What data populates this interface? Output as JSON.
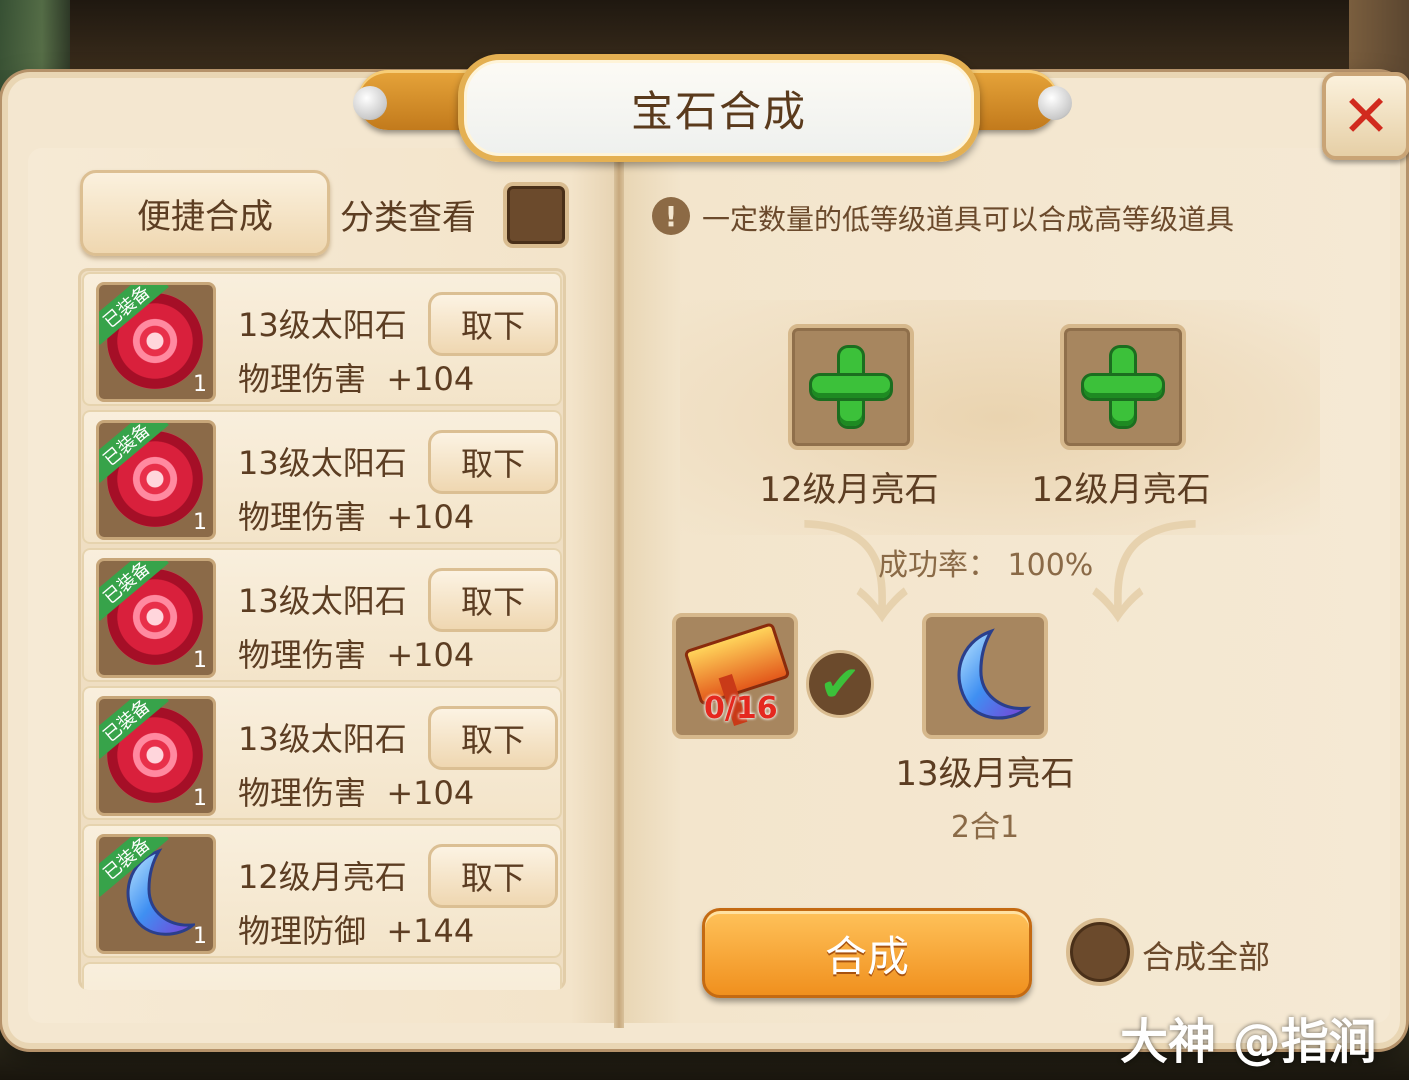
{
  "title": "宝石合成",
  "close_symbol": "✕",
  "left": {
    "quick_button": "便捷合成",
    "category_label": "分类查看",
    "items": [
      {
        "tag": "已装备",
        "name": "13级太阳石",
        "stat_name": "物理伤害",
        "stat_value": "+104",
        "count": "1",
        "button": "取下",
        "gem": "sun"
      },
      {
        "tag": "已装备",
        "name": "13级太阳石",
        "stat_name": "物理伤害",
        "stat_value": "+104",
        "count": "1",
        "button": "取下",
        "gem": "sun"
      },
      {
        "tag": "已装备",
        "name": "13级太阳石",
        "stat_name": "物理伤害",
        "stat_value": "+104",
        "count": "1",
        "button": "取下",
        "gem": "sun"
      },
      {
        "tag": "已装备",
        "name": "13级太阳石",
        "stat_name": "物理伤害",
        "stat_value": "+104",
        "count": "1",
        "button": "取下",
        "gem": "sun"
      },
      {
        "tag": "已装备",
        "name": "12级月亮石",
        "stat_name": "物理防御",
        "stat_value": "+144",
        "count": "1",
        "button": "取下",
        "gem": "moon"
      }
    ]
  },
  "right": {
    "info_icon": "!",
    "info_text": "一定数量的低等级道具可以合成高等级道具",
    "inputs": [
      {
        "label": "12级月亮石"
      },
      {
        "label": "12级月亮石"
      }
    ],
    "success_rate": "成功率： 100%",
    "hammer_count": "0/16",
    "result_name": "13级月亮石",
    "result_ratio": "2合1",
    "compose_button": "合成",
    "compose_all_label": "合成全部"
  },
  "watermark": "大神 @指涧",
  "colors": {
    "parchment": "#f4e7d0",
    "brown_text": "#5c3d22",
    "orange_button": "#f0901e",
    "green_plus": "#3cc13a",
    "close_red": "#d12a1e"
  }
}
